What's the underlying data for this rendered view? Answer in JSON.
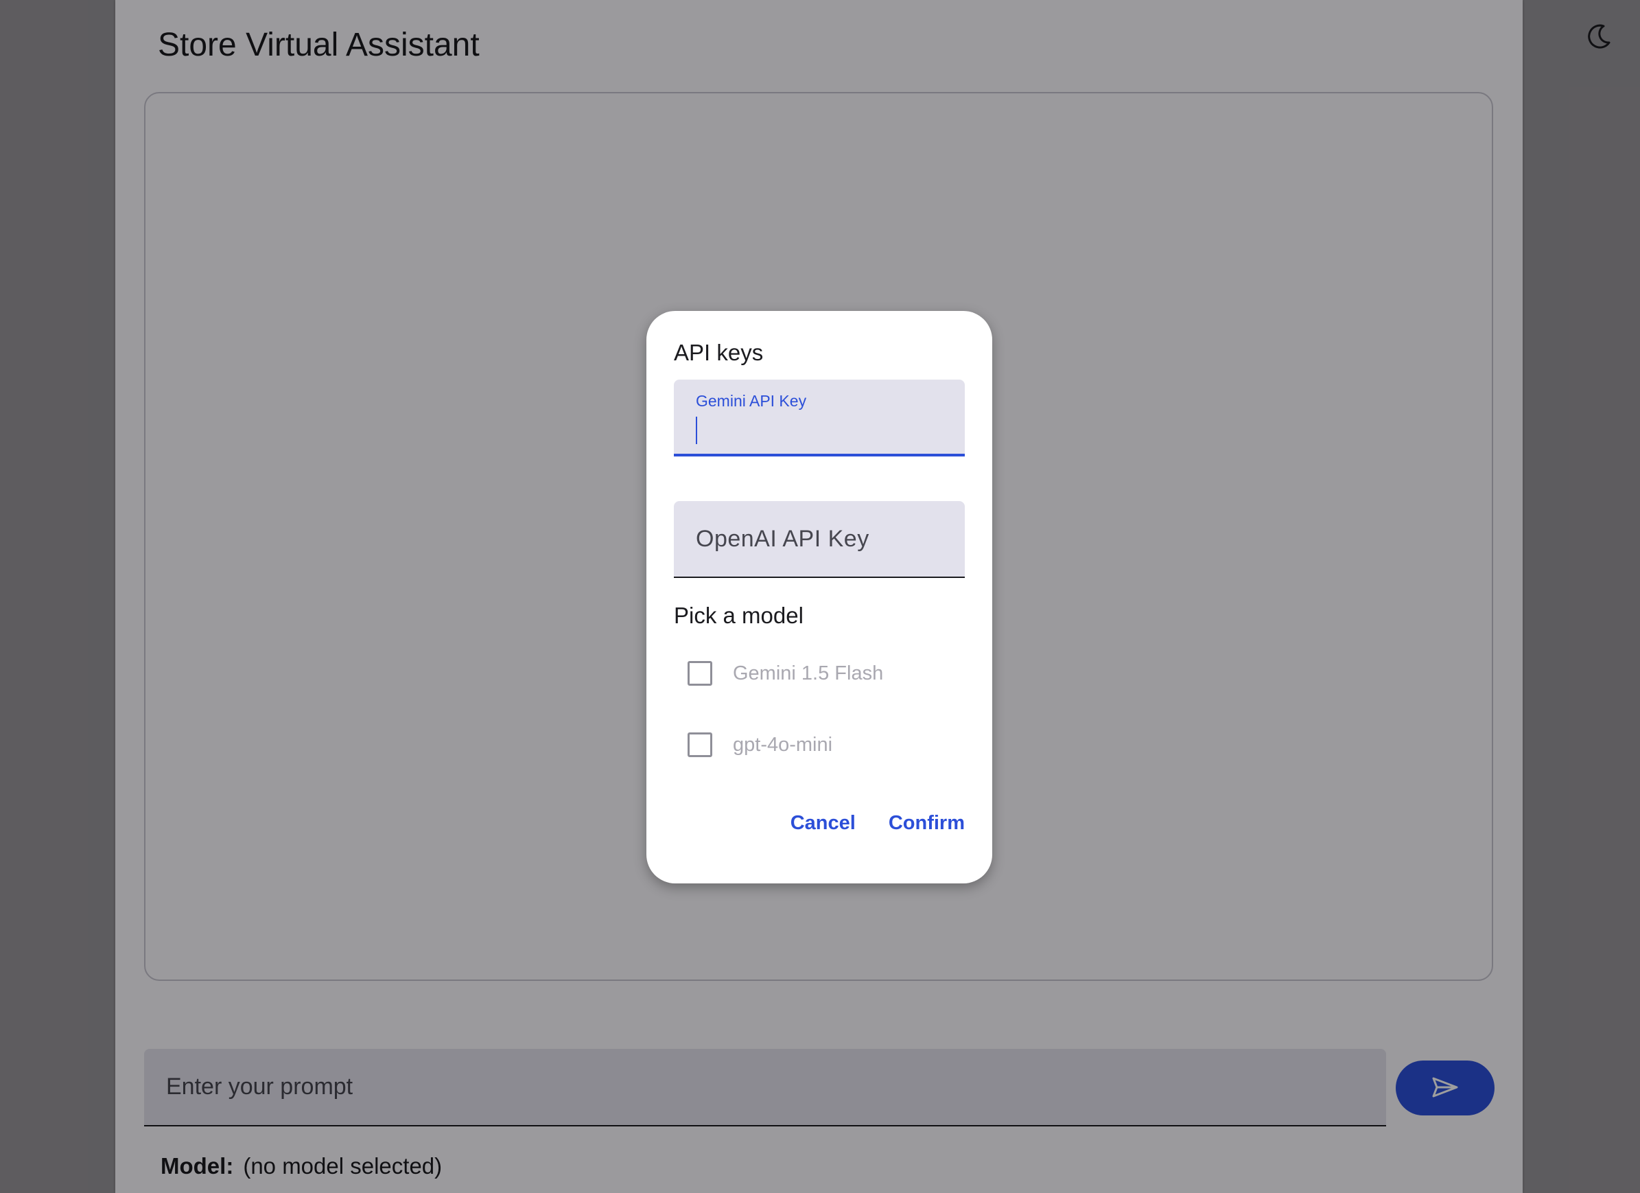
{
  "app": {
    "title": "Store Virtual Assistant"
  },
  "prompt": {
    "placeholder": "Enter your prompt"
  },
  "footer": {
    "model_label": "Model:",
    "model_value": "(no model selected)"
  },
  "icons": {
    "theme_toggle": "moon-icon",
    "send": "send-icon"
  },
  "dialog": {
    "title": "API keys",
    "gemini_field_label": "Gemini API Key",
    "openai_field_label": "OpenAI API Key",
    "section_label": "Pick a model",
    "models": [
      {
        "label": "Gemini 1.5 Flash",
        "checked": false
      },
      {
        "label": "gpt-4o-mini",
        "checked": false
      }
    ],
    "cancel_label": "Cancel",
    "confirm_label": "Confirm"
  },
  "colors": {
    "accent": "#2c4fd8",
    "field_bg": "#e2e1ec",
    "scrim": "rgba(0,0,0,0.38)"
  }
}
